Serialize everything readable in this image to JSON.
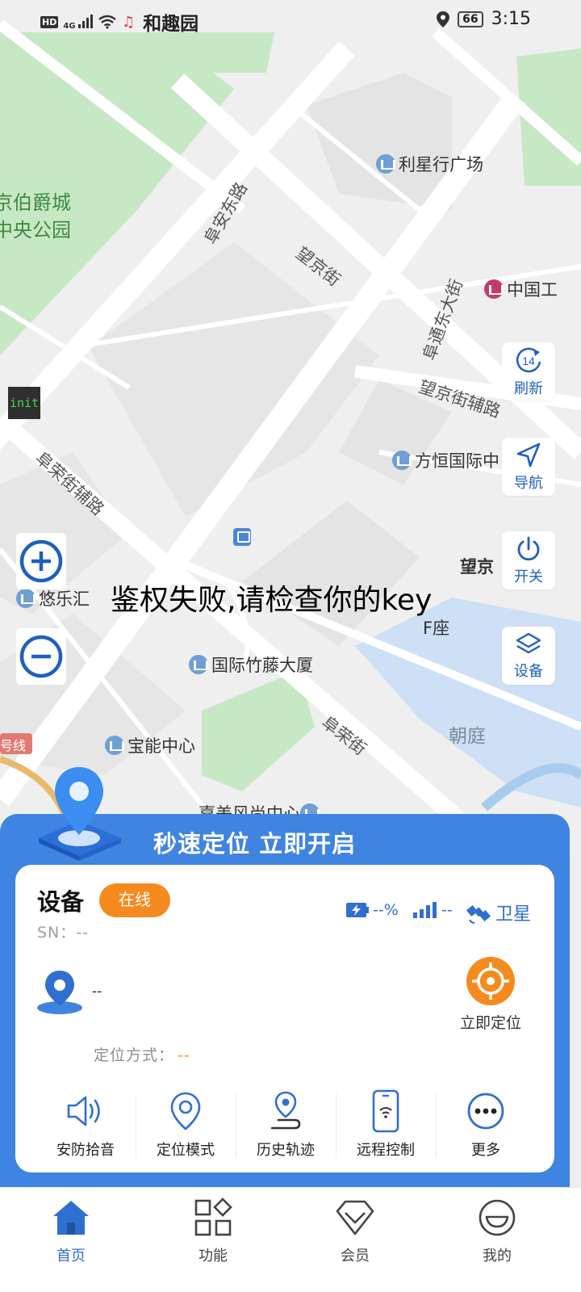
{
  "status_bar": {
    "title": "和趣园",
    "hd": "HD",
    "network": "4G",
    "battery": "66",
    "time": "3:15",
    "icons": [
      "hd-badge",
      "4g-signal-icon",
      "wifi-icon",
      "music-note-icon",
      "location-icon",
      "battery-icon"
    ]
  },
  "map": {
    "labels": {
      "park": "京伯爵城\n中央公园",
      "fuan_rd": "阜安东路",
      "wangjing_st": "望京街",
      "futong_st": "阜通东大街",
      "wangjing_aux": "望京街辅路",
      "furong_aux": "阜荣街辅路",
      "furong_st": "阜荣街",
      "lixinghang": "利星行广场",
      "zhongguo": "中国工",
      "fangheng": "方恒国际中",
      "wangjing": "望京",
      "f_block": "F座",
      "youlehui": "悠乐汇",
      "zhuteng": "国际竹藤大厦",
      "baoneng": "宝能中心",
      "fashion": "嘉美风尚中心",
      "chaoting": "朝庭",
      "metro_line": "号线"
    },
    "init_badge": "init",
    "auth_error": "鉴权失败,请检查你的key",
    "zoom_in_icon": "plus-circle-icon",
    "zoom_out_icon": "minus-circle-icon"
  },
  "tools": {
    "refresh": {
      "badge": "14",
      "label": "刷新",
      "icon": "refresh-icon"
    },
    "navigate": {
      "label": "导航",
      "icon": "navigation-arrow-icon"
    },
    "switch": {
      "label": "开关",
      "icon": "power-icon"
    },
    "device": {
      "label": "设备",
      "icon": "layers-icon"
    }
  },
  "panel": {
    "promo_text": "秒速定位 立即开启",
    "device_title": "设备",
    "status_badge": "在线",
    "sn": "SN：--",
    "battery": "--%",
    "signal": "--",
    "satellite": "卫星",
    "location_value": "--",
    "locate_now": "立即定位",
    "loc_mode_label": "定位方式：",
    "loc_mode_value": "--",
    "accent": "#3f84e0",
    "badge_color": "#f58b1f",
    "actions": [
      {
        "label": "安防拾音",
        "icon": "speaker-icon"
      },
      {
        "label": "定位模式",
        "icon": "location-pin-icon"
      },
      {
        "label": "历史轨迹",
        "icon": "track-history-icon"
      },
      {
        "label": "远程控制",
        "icon": "phone-remote-icon"
      },
      {
        "label": "更多",
        "icon": "more-icon"
      }
    ]
  },
  "tabbar": {
    "active": "home",
    "tabs": [
      {
        "label": "首页",
        "icon": "home-icon"
      },
      {
        "label": "功能",
        "icon": "grid-icon"
      },
      {
        "label": "会员",
        "icon": "vip-diamond-icon"
      },
      {
        "label": "我的",
        "icon": "profile-face-icon"
      }
    ]
  }
}
